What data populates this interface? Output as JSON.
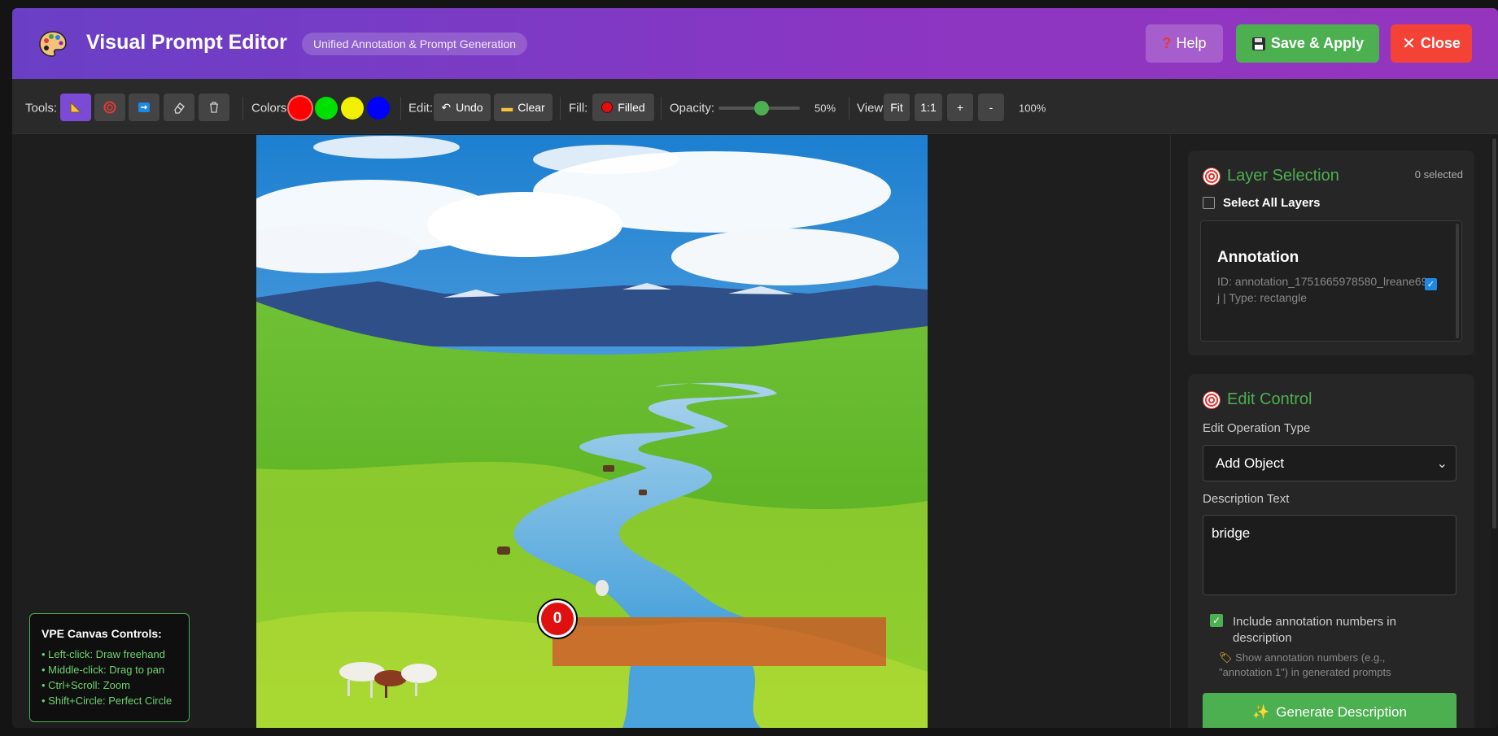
{
  "header": {
    "title": "Visual Prompt Editor",
    "subtitle": "Unified Annotation & Prompt Generation",
    "help_label": "Help",
    "save_label": "Save & Apply",
    "close_label": "Close"
  },
  "toolbar": {
    "tools_label": "Tools:",
    "colors_label": "Colors:",
    "edit_label": "Edit:",
    "undo_label": "Undo",
    "clear_label": "Clear",
    "fill_label": "Fill:",
    "filled_label": "Filled",
    "opacity_label": "Opacity:",
    "opacity_value": "50%",
    "view_label": "View:",
    "fit_label": "Fit",
    "one_to_one_label": "1:1",
    "zoom_in_label": "+",
    "zoom_out_label": "-",
    "zoom_value": "100%",
    "colors": [
      "#ff0000",
      "#00e000",
      "#f0f000",
      "#0000ff"
    ],
    "opacity_fraction": 0.5
  },
  "canvas": {
    "annotation_number": "0",
    "help": {
      "title": "VPE Canvas Controls:",
      "lines": [
        "• Left-click: Draw freehand",
        "• Middle-click: Drag to pan",
        "• Ctrl+Scroll: Zoom",
        "• Shift+Circle: Perfect Circle"
      ]
    }
  },
  "layers": {
    "title": "Layer Selection",
    "selected_count": "0 selected",
    "select_all_label": "Select All Layers",
    "items": [
      {
        "name": "Annotation",
        "meta": "ID: annotation_1751665978580_lreane69j | Type: rectangle"
      }
    ]
  },
  "edit_control": {
    "title": "Edit Control",
    "operation_label": "Edit Operation Type",
    "operation_value": "Add Object",
    "description_label": "Description Text",
    "description_value": "bridge",
    "include_label": "Include annotation numbers in description",
    "include_hint": "Show annotation numbers (e.g., \"annotation 1\") in generated prompts",
    "generate_label": "Generate Description"
  },
  "colors": {
    "header_start": "#6a3fc6",
    "header_end": "#9535bd",
    "save": "#4caf50",
    "close": "#f44336",
    "accent_green": "#4caf50",
    "annotation_red": "#e61e28"
  }
}
